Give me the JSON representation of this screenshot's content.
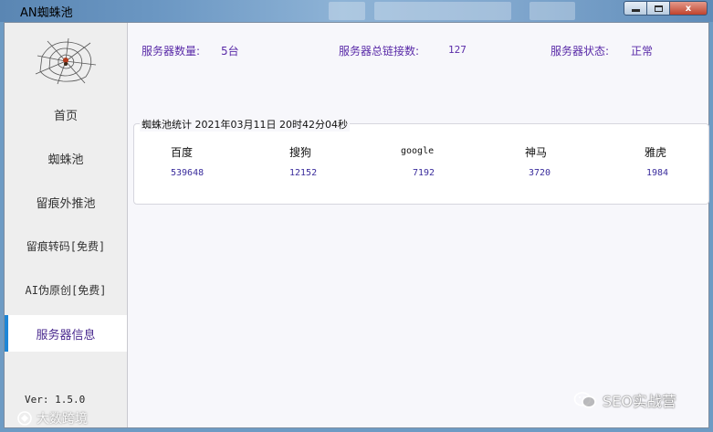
{
  "window": {
    "title": "AN蜘蛛池",
    "min_label": "",
    "max_label": "",
    "close_label": "x"
  },
  "sidebar": {
    "items": [
      {
        "label": "首页"
      },
      {
        "label": "蜘蛛池"
      },
      {
        "label": "留痕外推池"
      },
      {
        "label": "留痕转码[免费]"
      },
      {
        "label": "AI伪原创[免费]"
      },
      {
        "label": "服务器信息"
      }
    ],
    "active_index": 5,
    "version": "Ver: 1.5.0"
  },
  "stats": {
    "server_count_label": "服务器数量:",
    "server_count_value": "5台",
    "total_links_label": "服务器总链接数:",
    "total_links_value": "127",
    "status_label": "服务器状态:",
    "status_value": "正常"
  },
  "spider_stats": {
    "title": "蜘蛛池统计 2021年03月11日 20时42分04秒",
    "engines": [
      {
        "name": "百度",
        "value": "539648"
      },
      {
        "name": "搜狗",
        "value": "12152"
      },
      {
        "name": "google",
        "value": "7192"
      },
      {
        "name": "神马",
        "value": "3720"
      },
      {
        "name": "雅虎",
        "value": "1984"
      }
    ]
  },
  "watermarks": {
    "wechat": "SEO实战营",
    "bottom": "大数跨境"
  },
  "colors": {
    "accent": "#5a2ba8",
    "active_indicator": "#1e86d6",
    "titlebar": "#6e9bc4"
  }
}
